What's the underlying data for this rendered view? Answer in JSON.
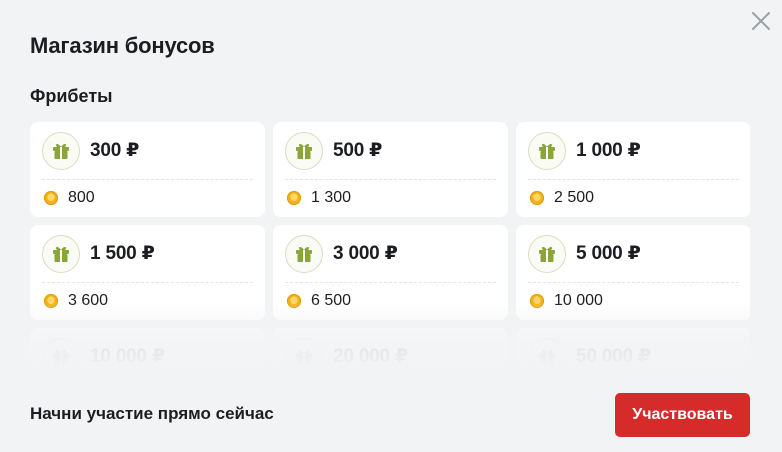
{
  "modal": {
    "title": "Магазин бонусов",
    "close_icon": "close-icon"
  },
  "section": {
    "title": "Фрибеты"
  },
  "freebets": [
    {
      "amount": "300 ₽",
      "price": "800"
    },
    {
      "amount": "500 ₽",
      "price": "1 300"
    },
    {
      "amount": "1 000 ₽",
      "price": "2 500"
    },
    {
      "amount": "1 500 ₽",
      "price": "3 600"
    },
    {
      "amount": "3 000 ₽",
      "price": "6 500"
    },
    {
      "amount": "5 000 ₽",
      "price": "10 000"
    },
    {
      "amount": "10 000 ₽"
    },
    {
      "amount": "20 000 ₽"
    },
    {
      "amount": "50 000 ₽"
    }
  ],
  "footer": {
    "text": "Начни участие прямо сейчас",
    "button_label": "Участвовать"
  },
  "icons": {
    "gift": "gift-icon",
    "coin": "coin-icon"
  },
  "colors": {
    "accent": "#d52b2b",
    "gift_green": "#8aa63a",
    "coin_gold": "#f3b21c",
    "background": "#f2f3f5"
  }
}
